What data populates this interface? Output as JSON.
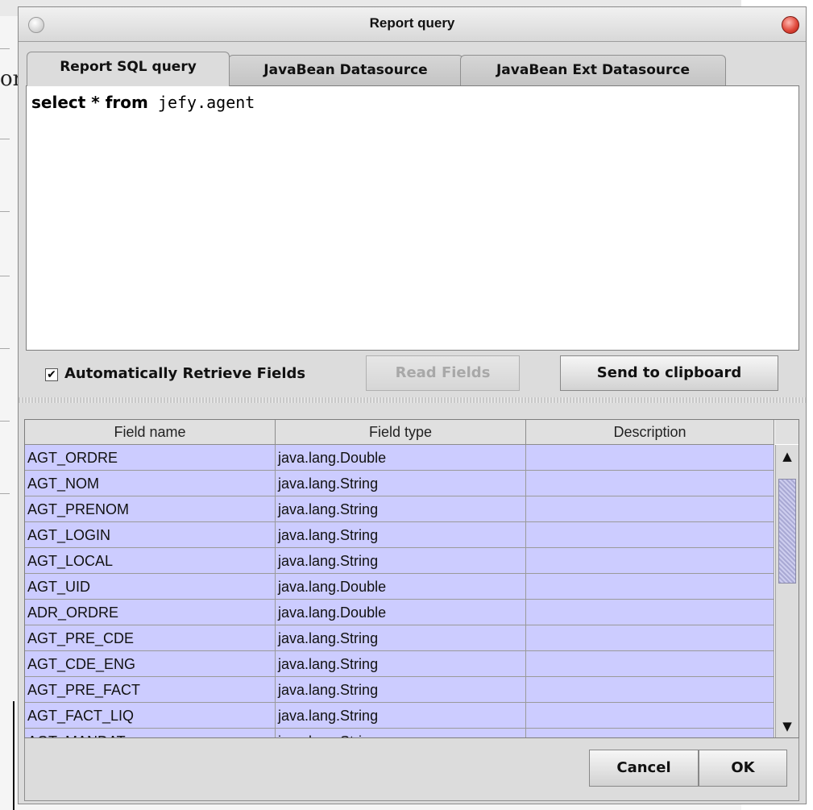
{
  "background": {
    "text_fragment": "orts."
  },
  "window": {
    "title": "Report query"
  },
  "tabs": [
    {
      "label": "Report SQL query",
      "active": true
    },
    {
      "label": "JavaBean Datasource",
      "active": false
    },
    {
      "label": "JavaBean Ext Datasource",
      "active": false
    }
  ],
  "query": {
    "keyword1": "select",
    "star": " * ",
    "keyword2": "from",
    "table": " jefy.agent"
  },
  "options": {
    "auto_retrieve_label": "Automatically Retrieve Fields",
    "auto_retrieve_checked": true,
    "checkmark": "✔",
    "read_fields_label": "Read Fields",
    "send_clipboard_label": "Send to clipboard"
  },
  "table": {
    "headers": [
      "Field name",
      "Field type",
      "Description"
    ],
    "rows": [
      [
        "AGT_ORDRE",
        "java.lang.Double",
        ""
      ],
      [
        "AGT_NOM",
        "java.lang.String",
        ""
      ],
      [
        "AGT_PRENOM",
        "java.lang.String",
        ""
      ],
      [
        "AGT_LOGIN",
        "java.lang.String",
        ""
      ],
      [
        "AGT_LOCAL",
        "java.lang.String",
        ""
      ],
      [
        "AGT_UID",
        "java.lang.Double",
        ""
      ],
      [
        "ADR_ORDRE",
        "java.lang.Double",
        ""
      ],
      [
        "AGT_PRE_CDE",
        "java.lang.String",
        ""
      ],
      [
        "AGT_CDE_ENG",
        "java.lang.String",
        ""
      ],
      [
        "AGT_PRE_FACT",
        "java.lang.String",
        ""
      ],
      [
        "AGT_FACT_LIQ",
        "java.lang.String",
        ""
      ],
      [
        "AGT_MANDAT",
        "java.lang.String",
        ""
      ]
    ],
    "row_color": "#ccccff"
  },
  "scrollbar": {
    "up_arrow": "▲",
    "down_arrow": "▼"
  },
  "footer": {
    "cancel_label": "Cancel",
    "ok_label": "OK"
  }
}
